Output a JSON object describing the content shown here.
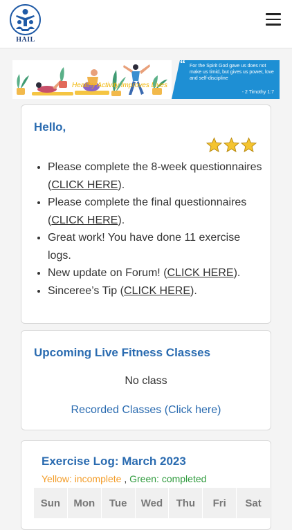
{
  "header": {
    "logo_text": "HAIL",
    "menu_icon": "hamburger-menu-icon"
  },
  "banner": {
    "caption": "Healthy Activity Improves Lives",
    "verse": "For the Spirit God gave us does not make us timid, but gives us power, love and self-discipline",
    "verse_ref": "- 2 Timothy 1:7",
    "accent": "#1e8fd4"
  },
  "welcome": {
    "greeting": "Hello,",
    "stars": 3,
    "items": [
      {
        "text": "Please complete the 8-week questionnaires (",
        "link": "CLICK HERE",
        "after": ")."
      },
      {
        "text": "Please complete the final questionnaires (",
        "link": "CLICK HERE",
        "after": ")."
      },
      {
        "text": "Great work! You have done 11 exercise logs.",
        "link": "",
        "after": ""
      },
      {
        "text": "New update on Forum! (",
        "link": "CLICK HERE",
        "after": ")."
      },
      {
        "text": "Sinceree’s Tip (",
        "link": "CLICK HERE",
        "after": ")."
      }
    ]
  },
  "classes": {
    "title": "Upcoming Live Fitness Classes",
    "status": "No class",
    "recorded_link": "Recorded Classes (Click here)"
  },
  "exercise_log": {
    "title": "Exercise Log: March 2023",
    "legend_yellow": "Yellow: incomplete",
    "legend_sep": " , ",
    "legend_green": "Green: completed",
    "days": [
      "Sun",
      "Mon",
      "Tue",
      "Wed",
      "Thu",
      "Fri",
      "Sat"
    ]
  },
  "colors": {
    "title_blue": "#2a6bb0",
    "incomplete": "#f39c28",
    "completed": "#2e9a3c"
  }
}
